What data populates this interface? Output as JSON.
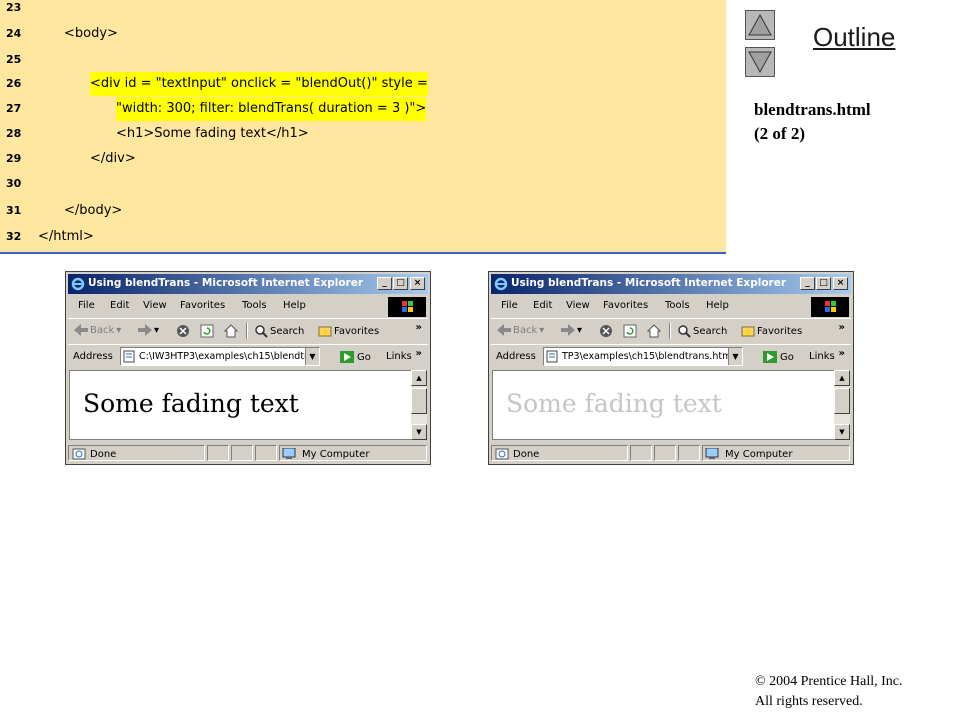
{
  "code_lines": [
    {
      "num": "23",
      "text": ""
    },
    {
      "num": "24",
      "text": "<body>"
    },
    {
      "num": "25",
      "text": ""
    },
    {
      "num": "26",
      "text": "<div id = \"textInput\" onclick = \"blendOut()\" style ="
    },
    {
      "num": "27",
      "text": "\"width: 300; filter: blendTrans( duration = 3 )\">"
    },
    {
      "num": "28",
      "text": "<h1>Some fading text</h1>"
    },
    {
      "num": "29",
      "text": "</div>"
    },
    {
      "num": "30",
      "text": ""
    },
    {
      "num": "31",
      "text": "</body>"
    },
    {
      "num": "32",
      "text": "</html>"
    }
  ],
  "side": {
    "outline_label": "Outline",
    "file_name": "blendtrans.html",
    "page_indicator": "(2 of 2)",
    "copyright_line1": "© 2004 Prentice Hall, Inc.",
    "copyright_line2": "All rights reserved."
  },
  "browsers": [
    {
      "title": "Using blendTrans - Microsoft Internet Explorer",
      "menu": [
        "File",
        "Edit",
        "View",
        "Favorites",
        "Tools",
        "Help"
      ],
      "back_label": "Back",
      "search_label": "Search",
      "favorites_label": "Favorites",
      "address_label": "Address",
      "url": "C:\\IW3HTP3\\examples\\ch15\\blendtr",
      "go_label": "Go",
      "links_label": "Links",
      "heading": "Some fading text",
      "heading_color": "#000000",
      "status_text": "Done",
      "zone_text": "My Computer"
    },
    {
      "title": "Using blendTrans - Microsoft Internet Explorer",
      "menu": [
        "File",
        "Edit",
        "View",
        "Favorites",
        "Tools",
        "Help"
      ],
      "back_label": "Back",
      "search_label": "Search",
      "favorites_label": "Favorites",
      "address_label": "Address",
      "url": "TP3\\examples\\ch15\\blendtrans.html",
      "go_label": "Go",
      "links_label": "Links",
      "heading": "Some fading text",
      "heading_color": "#c6c6c6",
      "status_text": "Done",
      "zone_text": "My Computer"
    }
  ]
}
